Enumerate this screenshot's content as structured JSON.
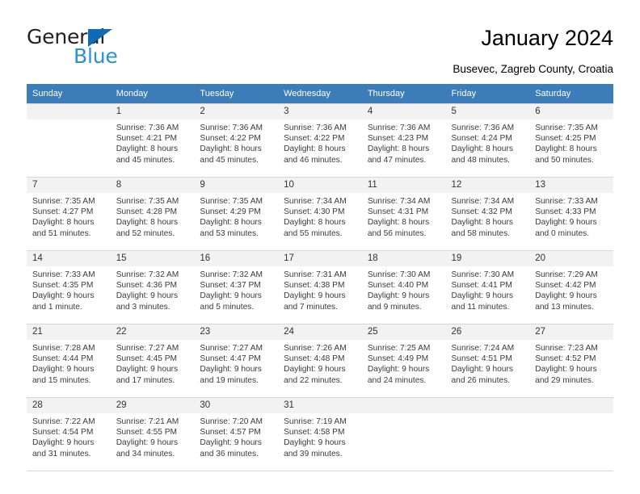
{
  "brand": {
    "name_part1": "General",
    "name_part2": "Blue",
    "color_dark": "#231f20",
    "color_blue": "#2a8fd4",
    "triangle_color": "#0d6cb5"
  },
  "header": {
    "title": "January 2024",
    "subtitle": "Busevec, Zagreb County, Croatia"
  },
  "theme": {
    "header_row_bg": "#3c7cb8",
    "daynum_bg": "#f2f2f2",
    "grid_line": "#d7d7d7"
  },
  "weekday_headers": [
    "Sunday",
    "Monday",
    "Tuesday",
    "Wednesday",
    "Thursday",
    "Friday",
    "Saturday"
  ],
  "weeks": [
    [
      {
        "day": "",
        "sunrise": "",
        "sunset": "",
        "daylight_line1": "",
        "daylight_line2": ""
      },
      {
        "day": "1",
        "sunrise": "Sunrise: 7:36 AM",
        "sunset": "Sunset: 4:21 PM",
        "daylight_line1": "Daylight: 8 hours",
        "daylight_line2": "and 45 minutes."
      },
      {
        "day": "2",
        "sunrise": "Sunrise: 7:36 AM",
        "sunset": "Sunset: 4:22 PM",
        "daylight_line1": "Daylight: 8 hours",
        "daylight_line2": "and 45 minutes."
      },
      {
        "day": "3",
        "sunrise": "Sunrise: 7:36 AM",
        "sunset": "Sunset: 4:22 PM",
        "daylight_line1": "Daylight: 8 hours",
        "daylight_line2": "and 46 minutes."
      },
      {
        "day": "4",
        "sunrise": "Sunrise: 7:36 AM",
        "sunset": "Sunset: 4:23 PM",
        "daylight_line1": "Daylight: 8 hours",
        "daylight_line2": "and 47 minutes."
      },
      {
        "day": "5",
        "sunrise": "Sunrise: 7:36 AM",
        "sunset": "Sunset: 4:24 PM",
        "daylight_line1": "Daylight: 8 hours",
        "daylight_line2": "and 48 minutes."
      },
      {
        "day": "6",
        "sunrise": "Sunrise: 7:35 AM",
        "sunset": "Sunset: 4:25 PM",
        "daylight_line1": "Daylight: 8 hours",
        "daylight_line2": "and 50 minutes."
      }
    ],
    [
      {
        "day": "7",
        "sunrise": "Sunrise: 7:35 AM",
        "sunset": "Sunset: 4:27 PM",
        "daylight_line1": "Daylight: 8 hours",
        "daylight_line2": "and 51 minutes."
      },
      {
        "day": "8",
        "sunrise": "Sunrise: 7:35 AM",
        "sunset": "Sunset: 4:28 PM",
        "daylight_line1": "Daylight: 8 hours",
        "daylight_line2": "and 52 minutes."
      },
      {
        "day": "9",
        "sunrise": "Sunrise: 7:35 AM",
        "sunset": "Sunset: 4:29 PM",
        "daylight_line1": "Daylight: 8 hours",
        "daylight_line2": "and 53 minutes."
      },
      {
        "day": "10",
        "sunrise": "Sunrise: 7:34 AM",
        "sunset": "Sunset: 4:30 PM",
        "daylight_line1": "Daylight: 8 hours",
        "daylight_line2": "and 55 minutes."
      },
      {
        "day": "11",
        "sunrise": "Sunrise: 7:34 AM",
        "sunset": "Sunset: 4:31 PM",
        "daylight_line1": "Daylight: 8 hours",
        "daylight_line2": "and 56 minutes."
      },
      {
        "day": "12",
        "sunrise": "Sunrise: 7:34 AM",
        "sunset": "Sunset: 4:32 PM",
        "daylight_line1": "Daylight: 8 hours",
        "daylight_line2": "and 58 minutes."
      },
      {
        "day": "13",
        "sunrise": "Sunrise: 7:33 AM",
        "sunset": "Sunset: 4:33 PM",
        "daylight_line1": "Daylight: 9 hours",
        "daylight_line2": "and 0 minutes."
      }
    ],
    [
      {
        "day": "14",
        "sunrise": "Sunrise: 7:33 AM",
        "sunset": "Sunset: 4:35 PM",
        "daylight_line1": "Daylight: 9 hours",
        "daylight_line2": "and 1 minute."
      },
      {
        "day": "15",
        "sunrise": "Sunrise: 7:32 AM",
        "sunset": "Sunset: 4:36 PM",
        "daylight_line1": "Daylight: 9 hours",
        "daylight_line2": "and 3 minutes."
      },
      {
        "day": "16",
        "sunrise": "Sunrise: 7:32 AM",
        "sunset": "Sunset: 4:37 PM",
        "daylight_line1": "Daylight: 9 hours",
        "daylight_line2": "and 5 minutes."
      },
      {
        "day": "17",
        "sunrise": "Sunrise: 7:31 AM",
        "sunset": "Sunset: 4:38 PM",
        "daylight_line1": "Daylight: 9 hours",
        "daylight_line2": "and 7 minutes."
      },
      {
        "day": "18",
        "sunrise": "Sunrise: 7:30 AM",
        "sunset": "Sunset: 4:40 PM",
        "daylight_line1": "Daylight: 9 hours",
        "daylight_line2": "and 9 minutes."
      },
      {
        "day": "19",
        "sunrise": "Sunrise: 7:30 AM",
        "sunset": "Sunset: 4:41 PM",
        "daylight_line1": "Daylight: 9 hours",
        "daylight_line2": "and 11 minutes."
      },
      {
        "day": "20",
        "sunrise": "Sunrise: 7:29 AM",
        "sunset": "Sunset: 4:42 PM",
        "daylight_line1": "Daylight: 9 hours",
        "daylight_line2": "and 13 minutes."
      }
    ],
    [
      {
        "day": "21",
        "sunrise": "Sunrise: 7:28 AM",
        "sunset": "Sunset: 4:44 PM",
        "daylight_line1": "Daylight: 9 hours",
        "daylight_line2": "and 15 minutes."
      },
      {
        "day": "22",
        "sunrise": "Sunrise: 7:27 AM",
        "sunset": "Sunset: 4:45 PM",
        "daylight_line1": "Daylight: 9 hours",
        "daylight_line2": "and 17 minutes."
      },
      {
        "day": "23",
        "sunrise": "Sunrise: 7:27 AM",
        "sunset": "Sunset: 4:47 PM",
        "daylight_line1": "Daylight: 9 hours",
        "daylight_line2": "and 19 minutes."
      },
      {
        "day": "24",
        "sunrise": "Sunrise: 7:26 AM",
        "sunset": "Sunset: 4:48 PM",
        "daylight_line1": "Daylight: 9 hours",
        "daylight_line2": "and 22 minutes."
      },
      {
        "day": "25",
        "sunrise": "Sunrise: 7:25 AM",
        "sunset": "Sunset: 4:49 PM",
        "daylight_line1": "Daylight: 9 hours",
        "daylight_line2": "and 24 minutes."
      },
      {
        "day": "26",
        "sunrise": "Sunrise: 7:24 AM",
        "sunset": "Sunset: 4:51 PM",
        "daylight_line1": "Daylight: 9 hours",
        "daylight_line2": "and 26 minutes."
      },
      {
        "day": "27",
        "sunrise": "Sunrise: 7:23 AM",
        "sunset": "Sunset: 4:52 PM",
        "daylight_line1": "Daylight: 9 hours",
        "daylight_line2": "and 29 minutes."
      }
    ],
    [
      {
        "day": "28",
        "sunrise": "Sunrise: 7:22 AM",
        "sunset": "Sunset: 4:54 PM",
        "daylight_line1": "Daylight: 9 hours",
        "daylight_line2": "and 31 minutes."
      },
      {
        "day": "29",
        "sunrise": "Sunrise: 7:21 AM",
        "sunset": "Sunset: 4:55 PM",
        "daylight_line1": "Daylight: 9 hours",
        "daylight_line2": "and 34 minutes."
      },
      {
        "day": "30",
        "sunrise": "Sunrise: 7:20 AM",
        "sunset": "Sunset: 4:57 PM",
        "daylight_line1": "Daylight: 9 hours",
        "daylight_line2": "and 36 minutes."
      },
      {
        "day": "31",
        "sunrise": "Sunrise: 7:19 AM",
        "sunset": "Sunset: 4:58 PM",
        "daylight_line1": "Daylight: 9 hours",
        "daylight_line2": "and 39 minutes."
      },
      {
        "day": "",
        "sunrise": "",
        "sunset": "",
        "daylight_line1": "",
        "daylight_line2": ""
      },
      {
        "day": "",
        "sunrise": "",
        "sunset": "",
        "daylight_line1": "",
        "daylight_line2": ""
      },
      {
        "day": "",
        "sunrise": "",
        "sunset": "",
        "daylight_line1": "",
        "daylight_line2": ""
      }
    ]
  ]
}
